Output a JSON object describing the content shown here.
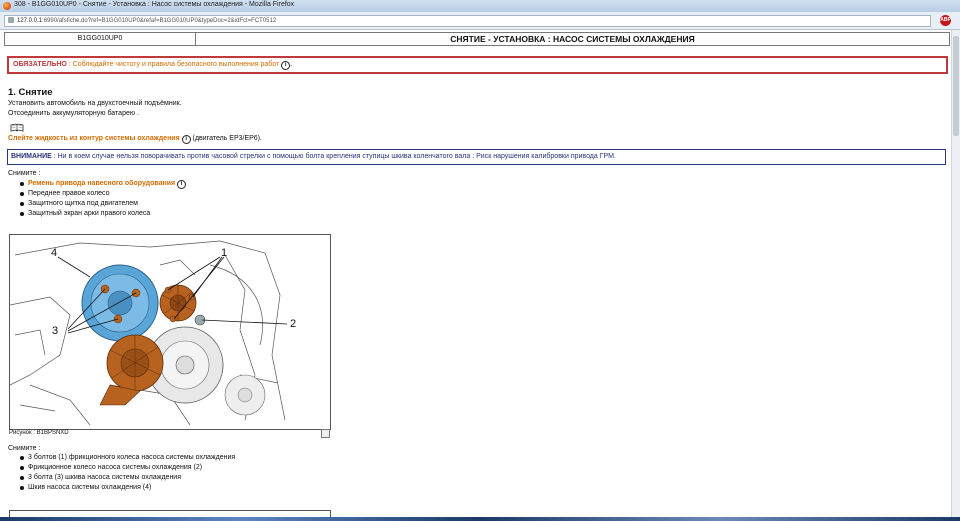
{
  "window": {
    "title": "308 - B1GG010UP0 - Снятие - Установка : Насос системы охлаждения - Mozilla Firefox",
    "url_host": "127.0.0.1",
    "url_rest": ":6990/afsfiche.do?ref=B1GG010UP0&refaf=B1GG010UP0&typeDoc=2&idFct=FCT0512"
  },
  "header": {
    "code": "B1GG010UP0",
    "title": "СНЯТИЕ - УСТАНОВКА : НАСОС СИСТЕМЫ ОХЛАЖДЕНИЯ"
  },
  "mandatory": {
    "label": "ОБЯЗАТЕЛЬНО",
    "text": " : Соблюдайте чистоту и правила безопасного выполнения работ",
    "info": "i",
    "tail": "."
  },
  "section1": {
    "title": "1. Снятие",
    "line1": "Установить автомобиль на двухстоечный подъёмник.",
    "line2": "Отсоединить аккумуляторную батарею .",
    "drain_link": "Слейте жидкость из контур системы охлаждения",
    "drain_note": " (двигатель EP3/EP6).",
    "attention_label": "ВНИМАНИЕ",
    "attention_text": " : Ни в коем случае нельзя поворачивать против часовой стрелки с помощью болта крепления ступицы шкива коленчатого вала : Риск нарушения калибровки привода ГРМ.",
    "remove_label": "Снимите :",
    "remove_items": [
      "Ремень привода навесного оборудования",
      "Переднее правое колесо",
      "Защитного щитка под двигателем",
      "Защитный экран арки правого колеса"
    ]
  },
  "figure": {
    "callouts": [
      "1",
      "2",
      "3",
      "4"
    ],
    "caption": "Рисунок : B1BPSNXD"
  },
  "section2": {
    "remove_label": "Снимите :",
    "items": [
      "3 болтов (1) фрикционного колеса  насоса системы охлаждения",
      "Фрикционное колесо насоса системы охлаждения (2)",
      "3 болта (3) шкива насоса системы охлаждения",
      "Шкив насоса системы охлаждения (4)"
    ]
  },
  "colors": {
    "mandatory": "#c0393b",
    "link": "#d36c00",
    "attention": "#27357a",
    "pulley": "#5aa5d8",
    "part": "#b8621f"
  }
}
